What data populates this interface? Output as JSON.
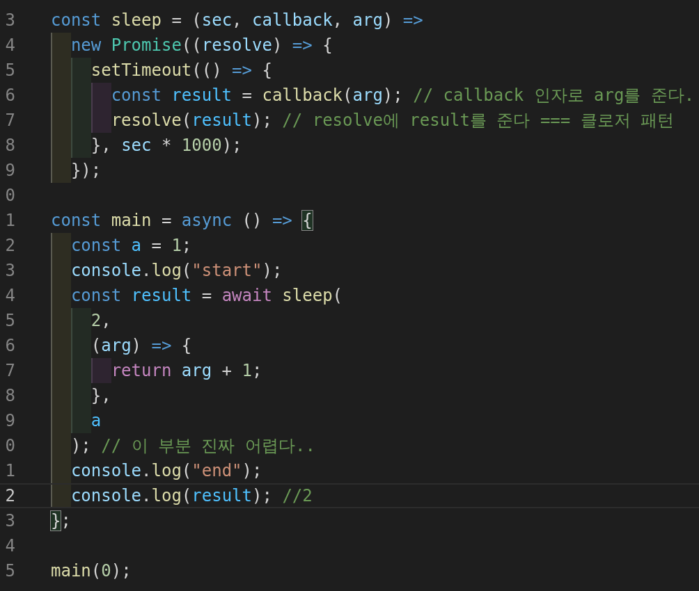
{
  "editor": {
    "lines": [
      {
        "number": "3",
        "current": false,
        "tokens": [
          {
            "kind": "keyword",
            "text": "const"
          },
          {
            "kind": "function",
            "text": " sleep"
          },
          {
            "kind": "punct",
            "text": " = ("
          },
          {
            "kind": "param",
            "text": "sec"
          },
          {
            "kind": "punct",
            "text": ", "
          },
          {
            "kind": "param",
            "text": "callback"
          },
          {
            "kind": "punct",
            "text": ", "
          },
          {
            "kind": "param",
            "text": "arg"
          },
          {
            "kind": "punct",
            "text": ") "
          },
          {
            "kind": "keyword",
            "text": "=>"
          }
        ]
      },
      {
        "number": "4",
        "current": false,
        "tokens": [
          {
            "kind": "keyword",
            "text": "  new"
          },
          {
            "kind": "class",
            "text": " Promise"
          },
          {
            "kind": "punct",
            "text": "(("
          },
          {
            "kind": "param",
            "text": "resolve"
          },
          {
            "kind": "punct",
            "text": ") "
          },
          {
            "kind": "keyword",
            "text": "=>"
          },
          {
            "kind": "punct",
            "text": " {"
          }
        ]
      },
      {
        "number": "5",
        "current": false,
        "tokens": [
          {
            "kind": "function",
            "text": "    setTimeout"
          },
          {
            "kind": "punct",
            "text": "(() "
          },
          {
            "kind": "keyword",
            "text": "=>"
          },
          {
            "kind": "punct",
            "text": " {"
          }
        ]
      },
      {
        "number": "6",
        "current": false,
        "tokens": [
          {
            "kind": "keyword",
            "text": "      const"
          },
          {
            "kind": "const",
            "text": " result"
          },
          {
            "kind": "punct",
            "text": " = "
          },
          {
            "kind": "function",
            "text": "callback"
          },
          {
            "kind": "punct",
            "text": "("
          },
          {
            "kind": "param",
            "text": "arg"
          },
          {
            "kind": "punct",
            "text": "); "
          },
          {
            "kind": "comment",
            "text": "// callback 인자로 arg를 준다."
          }
        ]
      },
      {
        "number": "7",
        "current": false,
        "tokens": [
          {
            "kind": "function",
            "text": "      resolve"
          },
          {
            "kind": "punct",
            "text": "("
          },
          {
            "kind": "const",
            "text": "result"
          },
          {
            "kind": "punct",
            "text": "); "
          },
          {
            "kind": "comment",
            "text": "// resolve에 result를 준다 === 클로저 패턴"
          }
        ]
      },
      {
        "number": "8",
        "current": false,
        "tokens": [
          {
            "kind": "punct",
            "text": "    }, "
          },
          {
            "kind": "param",
            "text": "sec"
          },
          {
            "kind": "punct",
            "text": " * "
          },
          {
            "kind": "number",
            "text": "1000"
          },
          {
            "kind": "punct",
            "text": ");"
          }
        ]
      },
      {
        "number": "9",
        "current": false,
        "tokens": [
          {
            "kind": "punct",
            "text": "  });"
          }
        ]
      },
      {
        "number": "0",
        "current": false
      },
      {
        "number": "1",
        "current": false,
        "tokens": [
          {
            "kind": "keyword",
            "text": "const"
          },
          {
            "kind": "function",
            "text": " main"
          },
          {
            "kind": "punct",
            "text": " = "
          },
          {
            "kind": "keyword",
            "text": "async"
          },
          {
            "kind": "punct",
            "text": " () "
          },
          {
            "kind": "keyword",
            "text": "=>"
          },
          {
            "kind": "bracket-match",
            "text": " {"
          }
        ]
      },
      {
        "number": "2",
        "current": false,
        "tokens": [
          {
            "kind": "keyword",
            "text": "  const"
          },
          {
            "kind": "const",
            "text": " a"
          },
          {
            "kind": "punct",
            "text": " = "
          },
          {
            "kind": "number",
            "text": "1"
          },
          {
            "kind": "punct",
            "text": ";"
          }
        ]
      },
      {
        "number": "3",
        "current": false,
        "tokens": [
          {
            "kind": "param",
            "text": "  console"
          },
          {
            "kind": "punct",
            "text": "."
          },
          {
            "kind": "function",
            "text": "log"
          },
          {
            "kind": "punct",
            "text": "("
          },
          {
            "kind": "string",
            "text": "\"start\""
          },
          {
            "kind": "punct",
            "text": ");"
          }
        ]
      },
      {
        "number": "4",
        "current": false,
        "tokens": [
          {
            "kind": "keyword",
            "text": "  const"
          },
          {
            "kind": "const",
            "text": " result"
          },
          {
            "kind": "punct",
            "text": " = "
          },
          {
            "kind": "control",
            "text": "await"
          },
          {
            "kind": "function",
            "text": " sleep"
          },
          {
            "kind": "punct",
            "text": "("
          }
        ]
      },
      {
        "number": "5",
        "current": false,
        "tokens": [
          {
            "kind": "number",
            "text": "    2"
          },
          {
            "kind": "punct",
            "text": ","
          }
        ]
      },
      {
        "number": "6",
        "current": false,
        "tokens": [
          {
            "kind": "punct",
            "text": "    ("
          },
          {
            "kind": "param",
            "text": "arg"
          },
          {
            "kind": "punct",
            "text": ") "
          },
          {
            "kind": "keyword",
            "text": "=>"
          },
          {
            "kind": "punct",
            "text": " {"
          }
        ]
      },
      {
        "number": "7",
        "current": false,
        "tokens": [
          {
            "kind": "control",
            "text": "      return"
          },
          {
            "kind": "param",
            "text": " arg"
          },
          {
            "kind": "punct",
            "text": " + "
          },
          {
            "kind": "number",
            "text": "1"
          },
          {
            "kind": "punct",
            "text": ";"
          }
        ]
      },
      {
        "number": "8",
        "current": false,
        "tokens": [
          {
            "kind": "punct",
            "text": "    },"
          }
        ]
      },
      {
        "number": "9",
        "current": false,
        "tokens": [
          {
            "kind": "const",
            "text": "    a"
          }
        ]
      },
      {
        "number": "0",
        "current": false,
        "tokens": [
          {
            "kind": "punct",
            "text": "  ); "
          },
          {
            "kind": "comment",
            "text": "// 이 부분 진짜 어렵다.."
          }
        ]
      },
      {
        "number": "1",
        "current": false,
        "tokens": [
          {
            "kind": "param",
            "text": "  console"
          },
          {
            "kind": "punct",
            "text": "."
          },
          {
            "kind": "function",
            "text": "log"
          },
          {
            "kind": "punct",
            "text": "("
          },
          {
            "kind": "string",
            "text": "\"end\""
          },
          {
            "kind": "punct",
            "text": ");"
          }
        ]
      },
      {
        "number": "2",
        "current": true,
        "tokens": [
          {
            "kind": "param",
            "text": "  console"
          },
          {
            "kind": "punct",
            "text": "."
          },
          {
            "kind": "function",
            "text": "log"
          },
          {
            "kind": "punct",
            "text": "("
          },
          {
            "kind": "const",
            "text": "result"
          },
          {
            "kind": "punct",
            "text": "); "
          },
          {
            "kind": "comment",
            "text": "//2"
          }
        ]
      },
      {
        "number": "3",
        "current": false,
        "tokens": [
          {
            "kind": "bracket-match",
            "text": "}"
          },
          {
            "kind": "punct",
            "text": ";"
          }
        ]
      },
      {
        "number": "4",
        "current": false
      },
      {
        "number": "5",
        "current": false,
        "tokens": [
          {
            "kind": "function",
            "text": "main"
          },
          {
            "kind": "punct",
            "text": "("
          },
          {
            "kind": "number",
            "text": "0"
          },
          {
            "kind": "punct",
            "text": ");"
          }
        ]
      }
    ]
  }
}
